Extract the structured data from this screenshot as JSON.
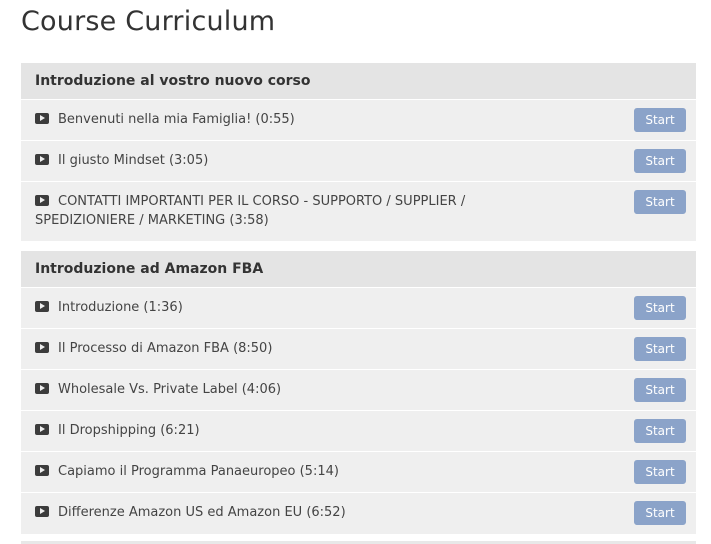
{
  "page_title": "Course Curriculum",
  "start_label": "Start",
  "colors": {
    "start_button": "#8ba3c9",
    "section_header": "#e4e4e4",
    "row_bg": "#efefef"
  },
  "sections": [
    {
      "title": "Introduzione al vostro nuovo corso",
      "lectures": [
        {
          "title": "Benvenuti nella mia Famiglia! (0:55)"
        },
        {
          "title": "Il giusto Mindset (3:05)"
        },
        {
          "title": "CONTATTI IMPORTANTI PER IL CORSO - SUPPORTO / SUPPLIER / SPEDIZIONIERE / MARKETING (3:58)"
        }
      ]
    },
    {
      "title": "Introduzione ad Amazon FBA",
      "lectures": [
        {
          "title": "Introduzione (1:36)"
        },
        {
          "title": "Il Processo di Amazon FBA (8:50)"
        },
        {
          "title": "Wholesale Vs. Private Label (4:06)"
        },
        {
          "title": "Il Dropshipping (6:21)"
        },
        {
          "title": "Capiamo il Programma Panaeuropeo (5:14)"
        },
        {
          "title": "Differenze Amazon US ed Amazon EU (6:52)"
        }
      ]
    }
  ]
}
